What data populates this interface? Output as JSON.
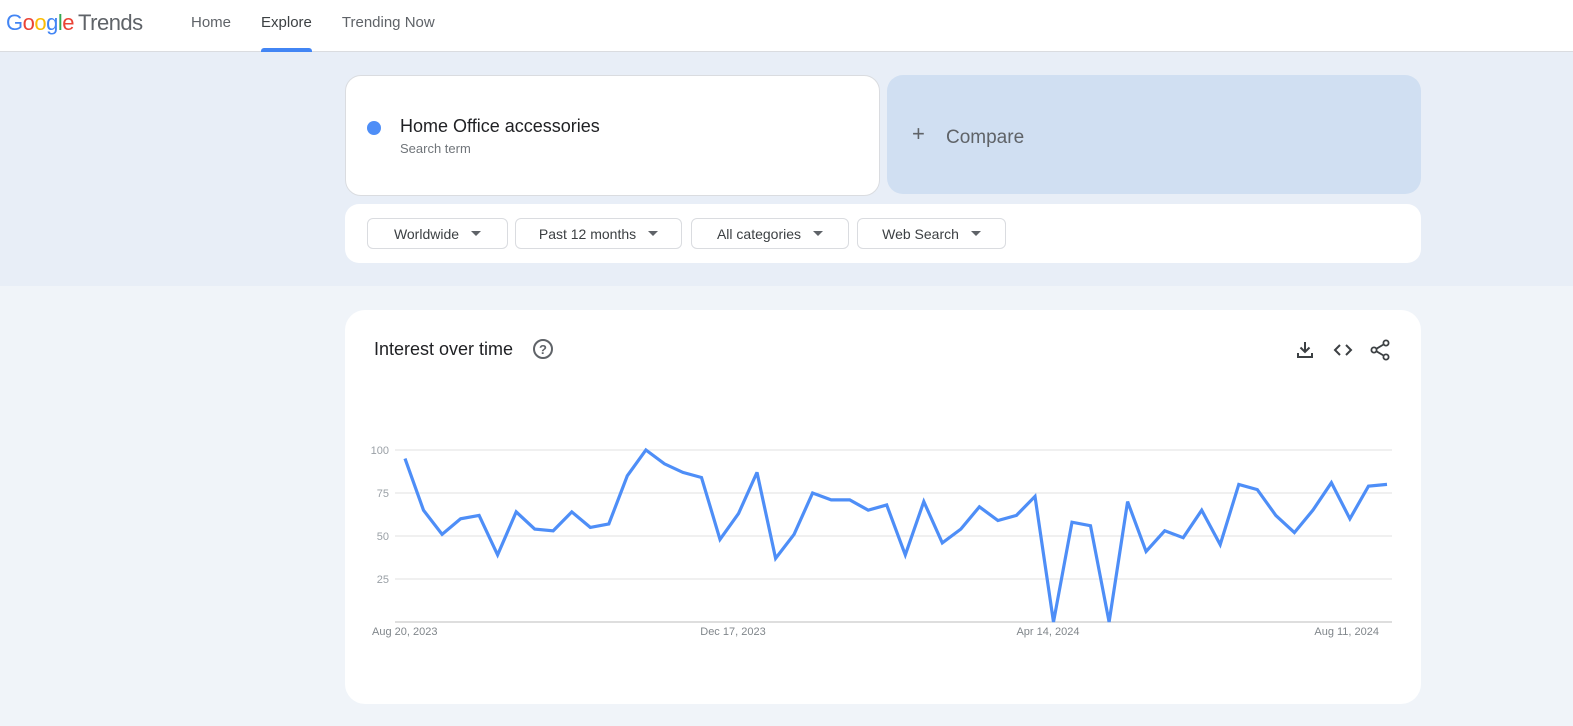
{
  "header": {
    "logo_google": [
      "G",
      "o",
      "o",
      "g",
      "l",
      "e"
    ],
    "logo_product": "Trends",
    "nav": [
      {
        "label": "Home",
        "active": false
      },
      {
        "label": "Explore",
        "active": true
      },
      {
        "label": "Trending Now",
        "active": false
      }
    ],
    "accent_color": "#4285f4"
  },
  "search": {
    "term": "Home Office accessories",
    "term_type": "Search term",
    "term_color": "#4e8ef7",
    "compare_icon": "plus-icon",
    "compare_label": "Compare"
  },
  "filters": [
    {
      "label": "Worldwide"
    },
    {
      "label": "Past 12 months"
    },
    {
      "label": "All categories"
    },
    {
      "label": "Web Search"
    }
  ],
  "chart_card": {
    "title": "Interest over time",
    "help_icon": "?",
    "actions": [
      "download-icon",
      "embed-code-icon",
      "share-icon"
    ]
  },
  "chart_data": {
    "type": "line",
    "title": "Interest over time",
    "xlabel": "",
    "ylabel": "",
    "ylim": [
      0,
      100
    ],
    "yticks": [
      25,
      50,
      75,
      100
    ],
    "ytick_labels": [
      "25",
      "50",
      "75",
      "100"
    ],
    "x_tick_labels": [
      {
        "label": "Aug 20, 2023",
        "index": 0
      },
      {
        "label": "Dec 17, 2023",
        "index": 17
      },
      {
        "label": "Apr 14, 2024",
        "index": 34
      },
      {
        "label": "Aug 11, 2024",
        "index": 51
      }
    ],
    "grid": true,
    "legend": "none",
    "series": [
      {
        "name": "Home Office accessories",
        "color": "#4e8ef7",
        "values": [
          95,
          65,
          51,
          60,
          62,
          39,
          64,
          54,
          53,
          64,
          55,
          57,
          85,
          100,
          92,
          87,
          84,
          48,
          63,
          87,
          37,
          51,
          75,
          71,
          71,
          65,
          68,
          39,
          70,
          46,
          54,
          67,
          59,
          62,
          73,
          0,
          58,
          56,
          0,
          70,
          41,
          53,
          49,
          65,
          45,
          80,
          77,
          62,
          52,
          65,
          81,
          60,
          79,
          80
        ]
      }
    ]
  }
}
